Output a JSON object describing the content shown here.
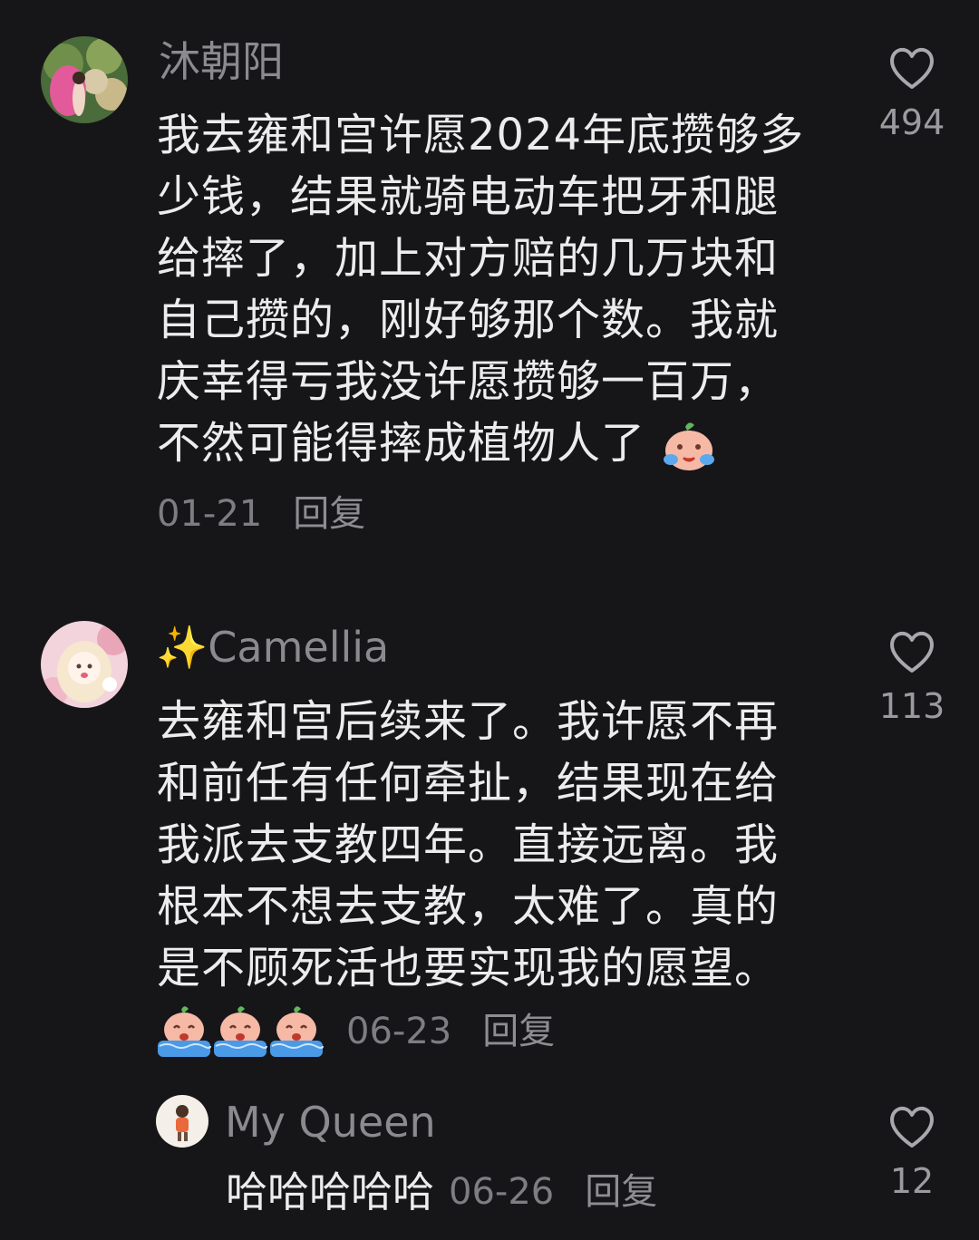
{
  "comments": [
    {
      "username": "沐朝阳",
      "lines": [
        "我去雍和宫许愿2024年底攒够多",
        "少钱，结果就骑电动车把牙和腿",
        "给摔了，加上对方赔的几万块和",
        "自己攒的，刚好够那个数。我就",
        "庆幸得亏我没许愿攒够一百万，",
        "不然可能得摔成植物人了"
      ],
      "emoji": "crying-peach-emoji",
      "date": "01-21",
      "reply_label": "回复",
      "likes": "494"
    },
    {
      "username_prefix": "✨",
      "username": "Camellia",
      "lines": [
        "去雍和宫后续来了。我许愿不再",
        "和前任有任何牵扯，结果现在给",
        "我派去支教四年。直接远离。我",
        "根本不想去支教，太难了。真的",
        "是不顾死活也要实现我的愿望。"
      ],
      "emoji": "crying-peach-flood-emoji",
      "emoji_count": 3,
      "date": "06-23",
      "reply_label": "回复",
      "likes": "113"
    },
    {
      "username": "My Queen",
      "text": "哈哈哈哈哈",
      "date": "06-26",
      "reply_label": "回复",
      "likes": "12"
    }
  ],
  "icons": {
    "like": "heart-outline-icon"
  },
  "colors": {
    "background": "#161619",
    "text": "#ececec",
    "muted": "#8b8b8f"
  }
}
